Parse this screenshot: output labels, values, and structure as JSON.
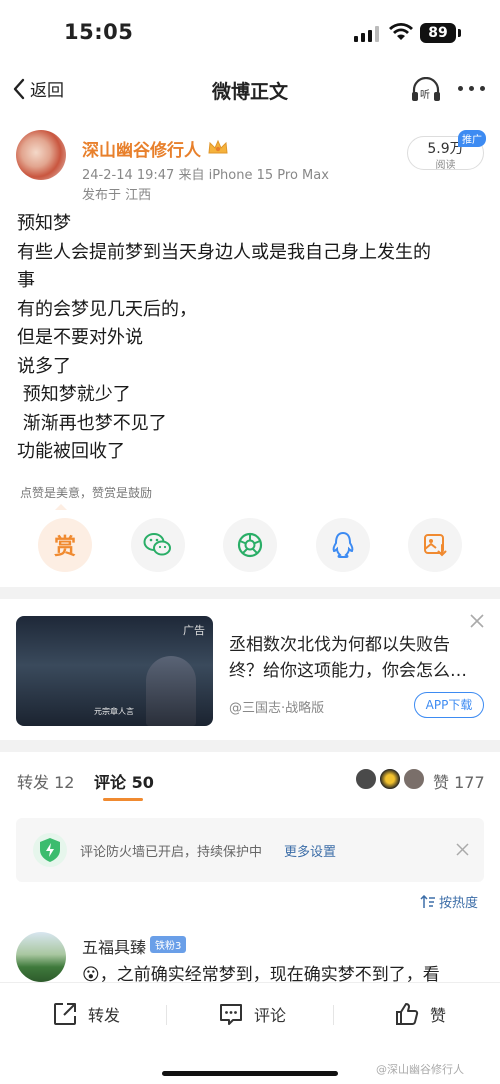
{
  "status_bar": {
    "time": "15:05",
    "battery": "89"
  },
  "nav": {
    "back_label": "返回",
    "title": "微博正文",
    "listen_label": "听"
  },
  "post": {
    "author": "深山幽谷修行人",
    "meta": "24-2-14 19:47  来自 iPhone 15 Pro Max",
    "location": "发布于 江西",
    "reads_count": "5.9万",
    "reads_label": "阅读",
    "promote_label": "推广",
    "lines": [
      "预知梦",
      "有些人会提前梦到当天身边人或是我自己身上发生的",
      "事",
      "有的会梦见几天后的，",
      "但是不要对外说",
      "说多了",
      " 预知梦就少了",
      " 渐渐再也梦不见了",
      "功能被回收了"
    ],
    "reward_tip": "点赞是美意，赞赏是鼓励",
    "reward_label": "赏"
  },
  "ad": {
    "tag": "广告",
    "image_caption": "元宗章人言",
    "title": "丞相数次北伐为何都以失败告终？给你这项能力，你会怎么…",
    "source": "@三国志·战略版",
    "download_label": "APP下载"
  },
  "tabs": {
    "repost_label": "转发 12",
    "comment_label": "评论 50",
    "like_label": "赞 177"
  },
  "firewall": {
    "text": "评论防火墙已开启，持续保护中",
    "link": "更多设置"
  },
  "sort": {
    "label": "按热度"
  },
  "comment": {
    "name": "五福具臻",
    "badge": "铁粉3",
    "text": "😮，之前确实经常梦到，现在确实梦不到了，看"
  },
  "bottom_bar": {
    "repost": "转发",
    "comment": "评论",
    "like": "赞",
    "watermark": "@深山幽谷修行人"
  },
  "colors": {
    "accent_orange": "#f08a30",
    "author_orange": "#e8802c",
    "link_blue": "#3d6ea8",
    "ad_blue": "#3d8bf2"
  }
}
